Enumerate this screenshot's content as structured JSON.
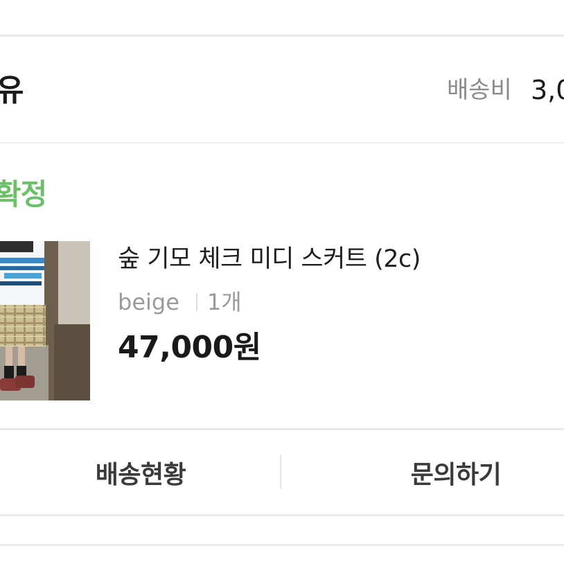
{
  "order": {
    "seller_name": "유",
    "shipping": {
      "label": "배송비",
      "value": "3,0"
    },
    "status": "확정",
    "status_color": "#6cc06a"
  },
  "product": {
    "name": "숲 기모 체크 미디 스커트 (2c)",
    "color": "beige",
    "quantity": "1개",
    "price": "47,000원",
    "thumbnail_icon": "product-photo"
  },
  "actions": {
    "track_label": "배송현황",
    "inquiry_label": "문의하기"
  }
}
